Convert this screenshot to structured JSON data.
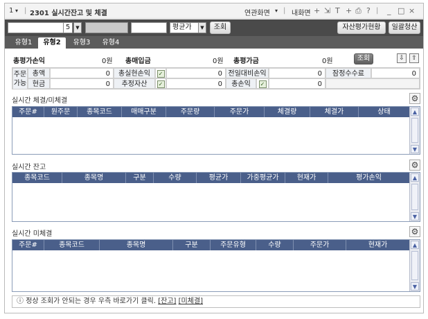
{
  "titlebar": {
    "window_num": "1",
    "title": "2301 실시간잔고 및 체결",
    "related": "연관화면",
    "my_screen": "내화면",
    "icons": [
      "dropdown-icon",
      "T",
      "+",
      "print-icon",
      "?"
    ],
    "win_controls": [
      "_",
      "□",
      "×"
    ]
  },
  "toolbar": {
    "account_suffix": "5",
    "avg_label": "평균가",
    "query": "조회",
    "asset_eval": "자산평가현황",
    "bulk_settle": "일괄청산"
  },
  "tabs": [
    {
      "label": "유형1",
      "active": false
    },
    {
      "label": "유형2",
      "active": true
    },
    {
      "label": "유형3",
      "active": false
    },
    {
      "label": "유형4",
      "active": false
    }
  ],
  "summary": {
    "total_pnl_label": "총평가손익",
    "total_pnl": "0원",
    "total_buy_label": "총매입금",
    "total_buy": "0원",
    "total_eval_label": "총평가금",
    "total_eval": "0원",
    "query": "조회"
  },
  "grid": {
    "order_avail": "주문가능",
    "amount_label": "총액",
    "amount": "0",
    "cash_label": "현금",
    "cash": "0",
    "realized_label": "총실현손익",
    "realized": "0",
    "est_asset_label": "추정자산",
    "est_asset": "0",
    "prev_label": "전일대비손익",
    "prev": "0",
    "total_pl_label": "총손익",
    "total_pl": "0",
    "fee_label": "잠정수수료",
    "fee": "0"
  },
  "sections": {
    "exec": {
      "title": "실시간 체결/미체결",
      "columns": [
        "주문#",
        "원주문",
        "종목코드",
        "매매구분",
        "주문량",
        "주문가",
        "체결량",
        "체결가",
        "상태"
      ]
    },
    "balance": {
      "title": "실시간 잔고",
      "columns": [
        "종목코드",
        "종목명",
        "구분",
        "수량",
        "평균가",
        "가중평균가",
        "현재가",
        "평가손익"
      ]
    },
    "unfilled": {
      "title": "실시간 미체결",
      "columns": [
        "주문#",
        "종목코드",
        "종목명",
        "구분",
        "주문유형",
        "수량",
        "주문가",
        "현재가"
      ]
    }
  },
  "footer": {
    "notice": "정상 조회가 안되는 경우 우측 바로가기 클릭.",
    "link_balance": "[잔고]",
    "link_unfilled": "[미체결]"
  }
}
